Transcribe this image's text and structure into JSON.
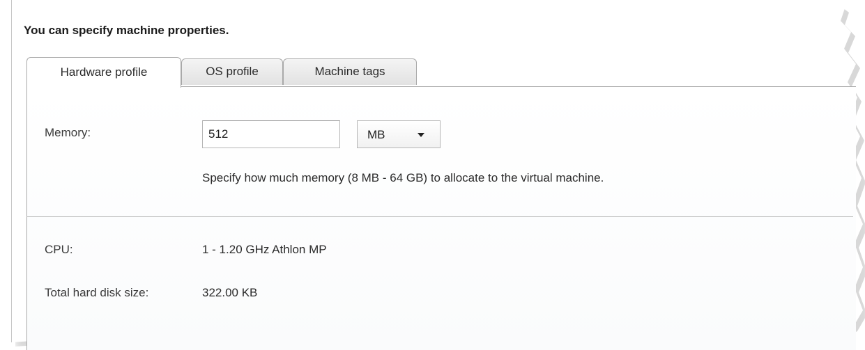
{
  "dialog": {
    "heading": "You can specify machine properties."
  },
  "tabs": [
    {
      "label": "Hardware profile",
      "active": true
    },
    {
      "label": "OS profile",
      "active": false
    },
    {
      "label": "Machine tags",
      "active": false
    }
  ],
  "memory": {
    "label": "Memory:",
    "value": "512",
    "unit": "MB",
    "hint": "Specify how much memory (8 MB - 64 GB) to allocate to the virtual machine."
  },
  "cpu": {
    "label": "CPU:",
    "value": "1 - 1.20 GHz Athlon MP"
  },
  "disk": {
    "label": "Total hard disk size:",
    "value": "322.00 KB"
  },
  "icons": {
    "dropdown": "chevron-down-icon"
  },
  "colors": {
    "border": "#a9a9a9",
    "text": "#2a2a2a",
    "inactive_tab": "#e2e2e2"
  }
}
